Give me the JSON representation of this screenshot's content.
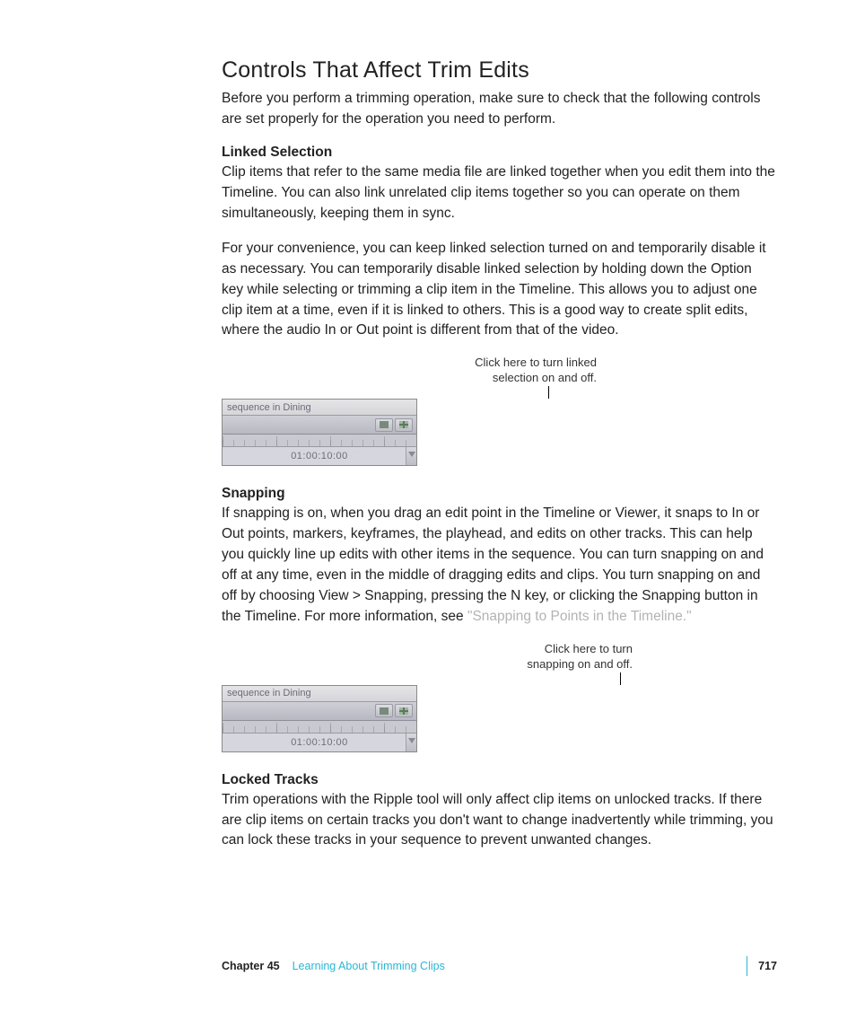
{
  "section_title": "Controls That Affect Trim Edits",
  "intro": "Before you perform a trimming operation, make sure to check that the following controls are set properly for the operation you need to perform.",
  "linked_selection": {
    "heading": "Linked Selection",
    "p1": "Clip items that refer to the same media file are linked together when you edit them into the Timeline. You can also link unrelated clip items together so you can operate on them simultaneously, keeping them in sync.",
    "p2": "For your convenience, you can keep linked selection turned on and temporarily disable it as necessary. You can temporarily disable linked selection by holding down the Option key while selecting or trimming a clip item in the Timeline. This allows you to adjust one clip item at a time, even if it is linked to others. This is a good way to create split edits, where the audio In or Out point is different from that of the video."
  },
  "fig1": {
    "callout_l1": "Click here to turn linked",
    "callout_l2": "selection on and off.",
    "tab_label": "sequence in Dining",
    "timecode": "01:00:10:00"
  },
  "snapping": {
    "heading": "Snapping",
    "p1_pre": "If snapping is on, when you drag an edit point in the Timeline or Viewer, it snaps to In or Out points, markers, keyframes, the playhead, and edits on other tracks. This can help you quickly line up edits with other items in the sequence. You can turn snapping on and off at any time, even in the middle of dragging edits and clips. You turn snapping on and off by choosing View > Snapping, pressing the N key, or clicking the Snapping button in the Timeline. For more information, see ",
    "p1_link": "\"Snapping to Points in the Timeline.\""
  },
  "fig2": {
    "callout_l1": "Click here to turn",
    "callout_l2": "snapping on and off.",
    "tab_label": "sequence in Dining",
    "timecode": "01:00:10:00"
  },
  "locked_tracks": {
    "heading": "Locked Tracks",
    "p1": "Trim operations with the Ripple tool will only affect clip items on unlocked tracks. If there are clip items on certain tracks you don't want to change inadvertently while trimming, you can lock these tracks in your sequence to prevent unwanted changes."
  },
  "footer": {
    "chapter_label": "Chapter 45",
    "chapter_title": "Learning About Trimming Clips",
    "page_number": "717"
  }
}
